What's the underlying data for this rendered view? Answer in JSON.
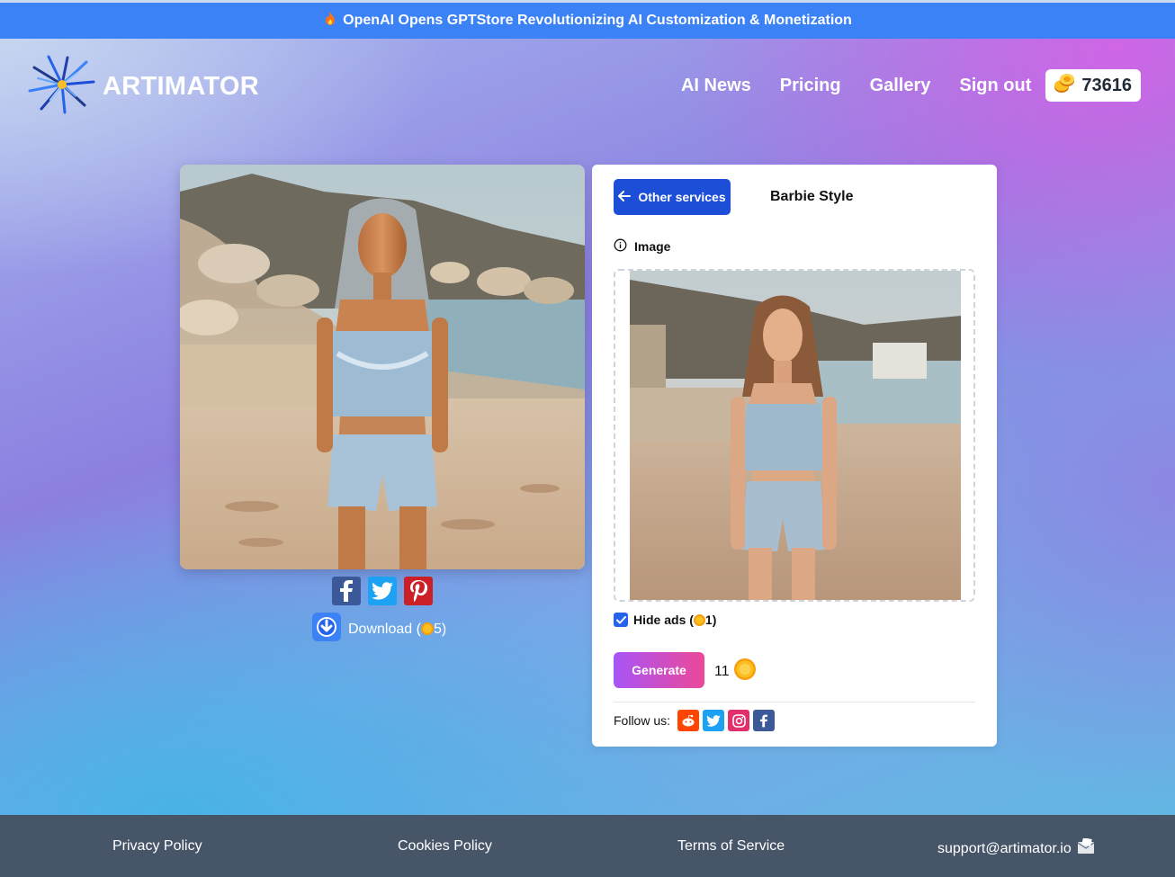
{
  "announcement": {
    "icon": "fire-icon",
    "text": "OpenAI Opens GPTStore Revolutionizing AI Customization & Monetization"
  },
  "header": {
    "logo_text": "ARTIMATOR",
    "nav": [
      "AI News",
      "Pricing",
      "Gallery",
      "Sign out"
    ],
    "coins": "73616"
  },
  "result": {
    "share": [
      "facebook-share-icon",
      "twitter-share-icon",
      "pinterest-share-icon"
    ],
    "download_label": "Download (",
    "download_cost": "5)"
  },
  "panel": {
    "back_label": "Other services",
    "service_title": "Barbie Style",
    "image_label": "Image",
    "hide_ads_label": "Hide ads (",
    "hide_ads_cost": "1)",
    "hide_ads_checked": true,
    "generate_label": "Generate",
    "cost": "11",
    "follow_label": "Follow us:",
    "socials": [
      "reddit-icon",
      "twitter-icon",
      "instagram-icon",
      "facebook-icon"
    ]
  },
  "footer": {
    "links": [
      "Privacy Policy",
      "Cookies Policy",
      "Terms of Service",
      "support@artimator.io"
    ]
  },
  "colors": {
    "accent_blue": "#1d4ed8",
    "announce_bar": "#3b82f6",
    "footer": "#475569",
    "generate_from": "#a855f7",
    "generate_to": "#ec4899"
  }
}
